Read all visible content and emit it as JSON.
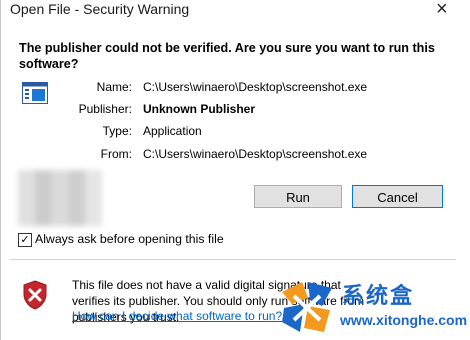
{
  "window": {
    "title": "Open File - Security Warning",
    "close_glyph": "×"
  },
  "warning": {
    "heading": "The publisher could not be verified.  Are you sure you want to run this software?"
  },
  "details": {
    "name_label": "Name:",
    "name_value": "C:\\Users\\winaero\\Desktop\\screenshot.exe",
    "publisher_label": "Publisher:",
    "publisher_value": "Unknown Publisher",
    "type_label": "Type:",
    "type_value": "Application",
    "from_label": "From:",
    "from_value": "C:\\Users\\winaero\\Desktop\\screenshot.exe"
  },
  "buttons": {
    "run": "Run",
    "cancel": "Cancel"
  },
  "checkbox": {
    "checked": true,
    "mark": "✓",
    "label": "Always ask before opening this file"
  },
  "info": {
    "text": "This file does not have a valid digital signature that verifies its publisher.  You should only run software from publishers you trust.",
    "link": "How can I decide what software to run?"
  },
  "watermark": {
    "brand_cn": "系统盒",
    "url": "www.xitonghe.com"
  },
  "colors": {
    "link": "#0066cc",
    "shield_red": "#c4262e",
    "watermark_blue": "#1b67c9",
    "watermark_orange": "#f39a1e"
  },
  "icons": {
    "file": "program-file-icon",
    "shield": "security-shield-icon",
    "close": "close-icon",
    "watermark_logo": "xitonghe-logo-icon"
  }
}
